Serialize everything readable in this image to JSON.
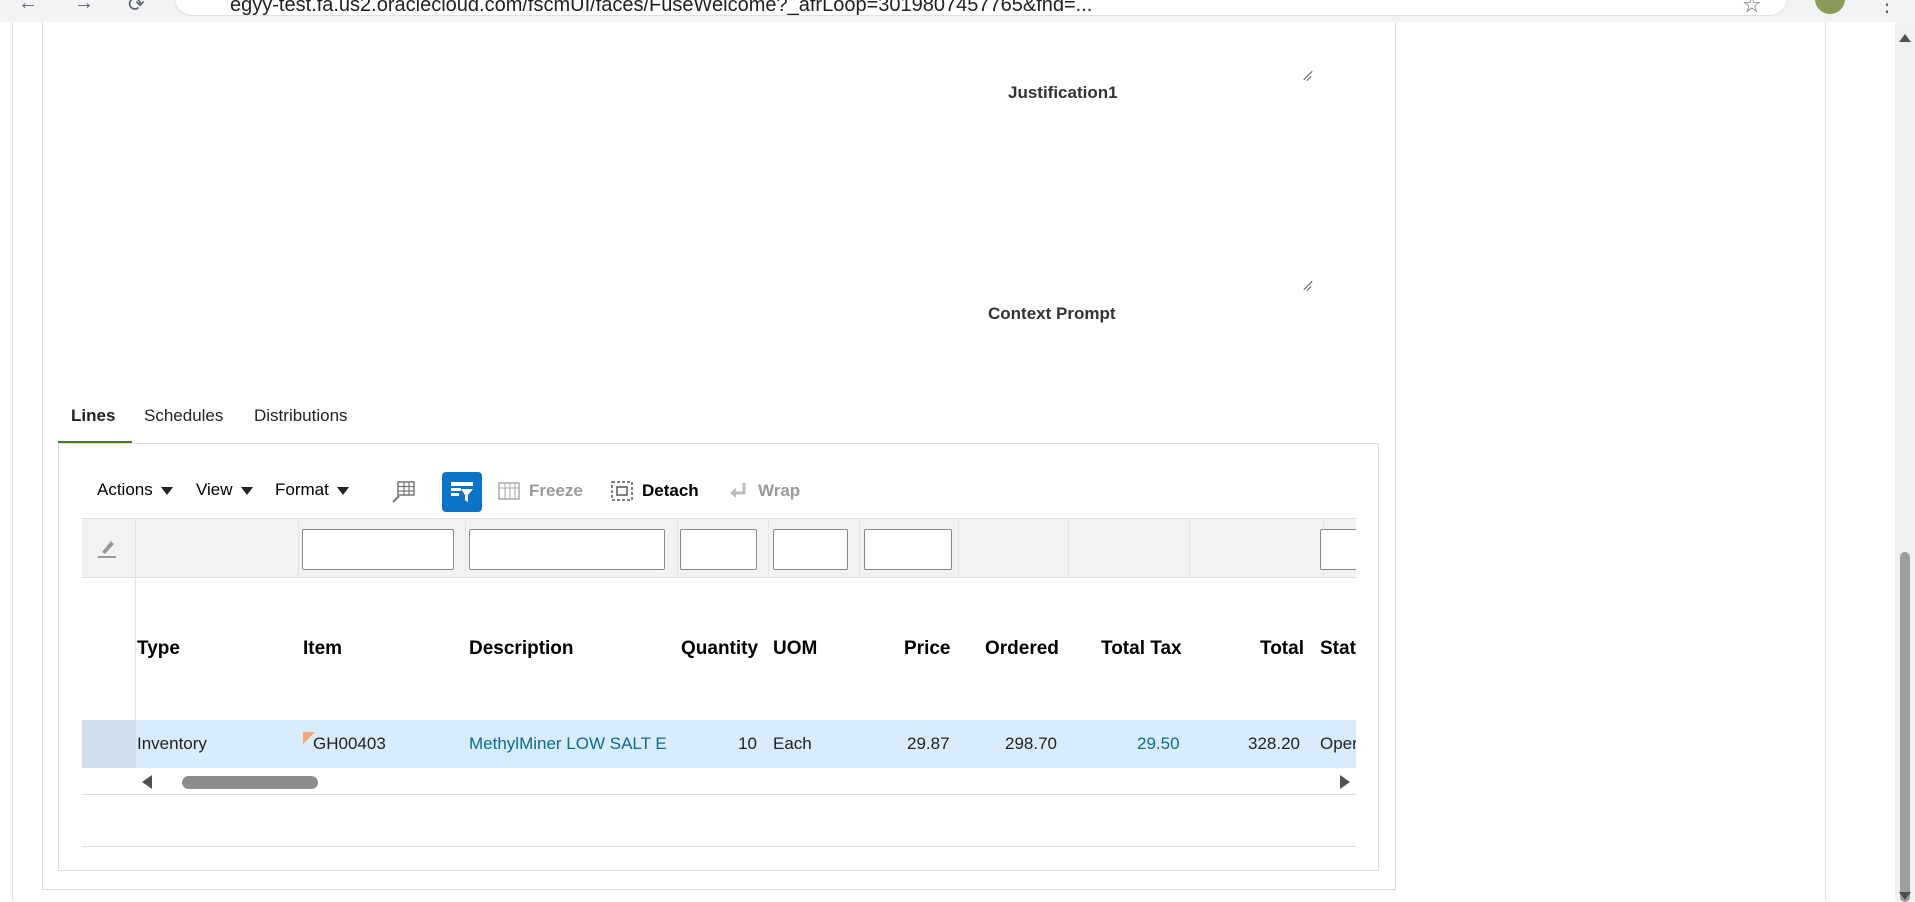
{
  "browser": {
    "url": "egyy-test.fa.us2.oraclecloud.com/fscmUI/faces/FuseWelcome?_afrLoop=3019807457765&fnd=...",
    "nav_back": "←",
    "nav_forward": "→",
    "nav_reload": "⟳",
    "star": "☆",
    "menu": "⋮"
  },
  "form": {
    "justification_label": "Justification1",
    "context_prompt_label": "Context Prompt"
  },
  "tabs": [
    {
      "label": "Lines",
      "active": true
    },
    {
      "label": "Schedules",
      "active": false
    },
    {
      "label": "Distributions",
      "active": false
    }
  ],
  "toolbar": {
    "actions_label": "Actions",
    "view_label": "View",
    "format_label": "Format",
    "freeze_label": "Freeze",
    "detach_label": "Detach",
    "wrap_label": "Wrap"
  },
  "table": {
    "columns": [
      "Type",
      "Item",
      "Description",
      "Quantity",
      "UOM",
      "Price",
      "Ordered",
      "Total Tax",
      "Total",
      "Stat"
    ],
    "rows": [
      {
        "type": "Inventory",
        "item": "GH00403",
        "description": "MethylMiner LOW SALT E",
        "quantity": "10",
        "uom": "Each",
        "price": "29.87",
        "ordered": "298.70",
        "total_tax": "29.50",
        "total": "328.20",
        "status": "Oper"
      }
    ]
  },
  "colors": {
    "tab_active_underline": "#4a7c2a",
    "selected_icon_bg": "#0b74c9",
    "row_highlight": "#d9ecfb",
    "link": "#0b6c8c"
  }
}
